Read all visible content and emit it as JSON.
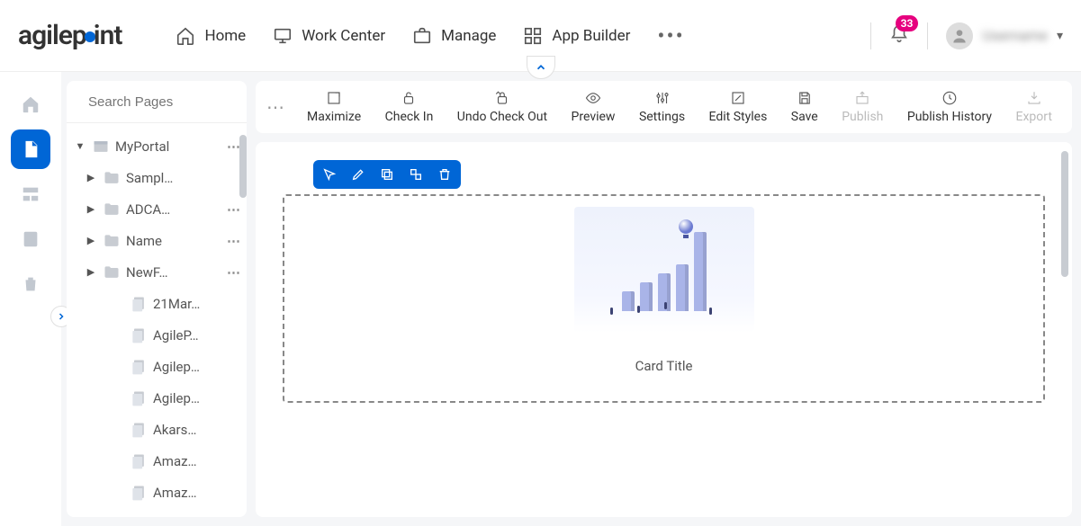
{
  "brand": {
    "text_a": "agilep",
    "text_b": "int"
  },
  "nav": {
    "items": [
      {
        "id": "home",
        "label": "Home"
      },
      {
        "id": "work-center",
        "label": "Work Center"
      },
      {
        "id": "manage",
        "label": "Manage"
      },
      {
        "id": "app-builder",
        "label": "App Builder"
      }
    ],
    "notification_count": "33",
    "username": "Username"
  },
  "sidebar": {
    "items": [
      {
        "id": "home-icon"
      },
      {
        "id": "page-icon",
        "active": true
      },
      {
        "id": "layout-icon"
      },
      {
        "id": "list-icon"
      },
      {
        "id": "trash-icon"
      }
    ]
  },
  "search": {
    "placeholder": "Search Pages"
  },
  "tree": [
    {
      "depth": 0,
      "expanded": true,
      "kind": "root",
      "label": "MyPortal",
      "more": true
    },
    {
      "depth": 1,
      "expanded": false,
      "kind": "folder",
      "label": "Sampl…",
      "more": false
    },
    {
      "depth": 1,
      "expanded": false,
      "kind": "folder",
      "label": "ADCA…",
      "more": true
    },
    {
      "depth": 1,
      "expanded": false,
      "kind": "folder",
      "label": "Name",
      "more": true
    },
    {
      "depth": 1,
      "expanded": false,
      "kind": "folder",
      "label": "NewF…",
      "more": true
    },
    {
      "depth": 2,
      "expanded": null,
      "kind": "page",
      "label": "21Mar…",
      "more": false
    },
    {
      "depth": 2,
      "expanded": null,
      "kind": "page",
      "label": "AgileP…",
      "more": false
    },
    {
      "depth": 2,
      "expanded": null,
      "kind": "page",
      "label": "Agilep…",
      "more": false
    },
    {
      "depth": 2,
      "expanded": null,
      "kind": "page",
      "label": "Agilep…",
      "more": false
    },
    {
      "depth": 2,
      "expanded": null,
      "kind": "page",
      "label": "Akars…",
      "more": false
    },
    {
      "depth": 2,
      "expanded": null,
      "kind": "page",
      "label": "Amaz…",
      "more": false
    },
    {
      "depth": 2,
      "expanded": null,
      "kind": "page",
      "label": "Amaz…",
      "more": false
    }
  ],
  "toolbar": {
    "items": [
      {
        "id": "maximize",
        "label": "Maximize",
        "disabled": false
      },
      {
        "id": "check-in",
        "label": "Check In",
        "disabled": false
      },
      {
        "id": "undo-check-out",
        "label": "Undo Check Out",
        "disabled": false
      },
      {
        "id": "preview",
        "label": "Preview",
        "disabled": false
      },
      {
        "id": "settings",
        "label": "Settings",
        "disabled": false
      },
      {
        "id": "edit-styles",
        "label": "Edit Styles",
        "disabled": false
      },
      {
        "id": "save",
        "label": "Save",
        "disabled": false
      },
      {
        "id": "publish",
        "label": "Publish",
        "disabled": true
      },
      {
        "id": "publish-history",
        "label": "Publish History",
        "disabled": false
      },
      {
        "id": "export",
        "label": "Export",
        "disabled": true
      }
    ]
  },
  "widget_toolbar": {
    "items": [
      {
        "id": "cursor"
      },
      {
        "id": "edit"
      },
      {
        "id": "copy"
      },
      {
        "id": "move"
      },
      {
        "id": "delete"
      }
    ]
  },
  "card": {
    "title": "Card Title"
  }
}
